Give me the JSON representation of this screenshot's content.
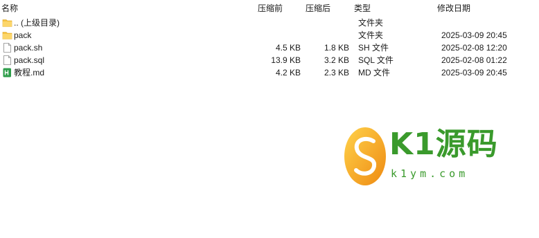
{
  "columns": {
    "name": "名称",
    "size": "压缩前",
    "compressed": "压缩后",
    "type": "类型",
    "modified": "修改日期"
  },
  "rows": [
    {
      "name": ".. (上级目录)",
      "size": "",
      "compressed": "",
      "type": "文件夹",
      "modified": "",
      "icon": "folder-icon"
    },
    {
      "name": "pack",
      "size": "",
      "compressed": "",
      "type": "文件夹",
      "modified": "2025-03-09 20:45",
      "icon": "folder-icon"
    },
    {
      "name": "pack.sh",
      "size": "4.5 KB",
      "compressed": "1.8 KB",
      "type": "SH 文件",
      "modified": "2025-02-08 12:20",
      "icon": "file-icon"
    },
    {
      "name": "pack.sql",
      "size": "13.9 KB",
      "compressed": "3.2 KB",
      "type": "SQL 文件",
      "modified": "2025-02-08 01:22",
      "icon": "file-icon"
    },
    {
      "name": "教程.md",
      "size": "4.2 KB",
      "compressed": "2.3 KB",
      "type": "MD 文件",
      "modified": "2025-03-09 20:45",
      "icon": "markdown-icon"
    }
  ],
  "watermark": {
    "main": "K1源码",
    "sub": "k1ym.com"
  },
  "colors": {
    "folder": "#f6c343",
    "watermark_green": "#3a9a2c",
    "watermark_orange": "#f0a020"
  }
}
